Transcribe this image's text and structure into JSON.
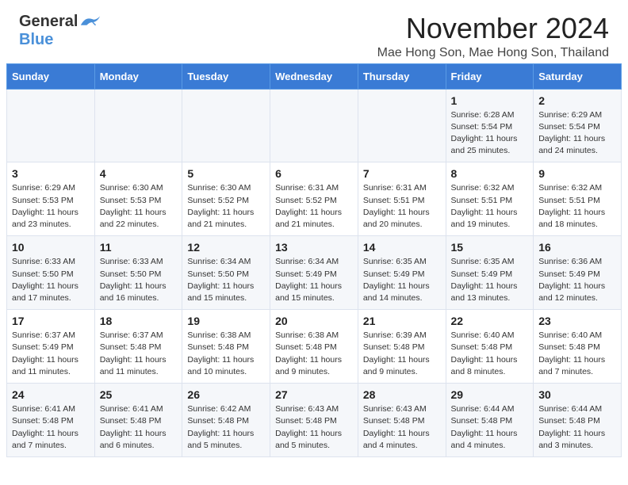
{
  "logo": {
    "general": "General",
    "blue": "Blue"
  },
  "title": "November 2024",
  "location": "Mae Hong Son, Mae Hong Son, Thailand",
  "weekdays": [
    "Sunday",
    "Monday",
    "Tuesday",
    "Wednesday",
    "Thursday",
    "Friday",
    "Saturday"
  ],
  "weeks": [
    [
      {
        "day": "",
        "info": ""
      },
      {
        "day": "",
        "info": ""
      },
      {
        "day": "",
        "info": ""
      },
      {
        "day": "",
        "info": ""
      },
      {
        "day": "",
        "info": ""
      },
      {
        "day": "1",
        "info": "Sunrise: 6:28 AM\nSunset: 5:54 PM\nDaylight: 11 hours\nand 25 minutes."
      },
      {
        "day": "2",
        "info": "Sunrise: 6:29 AM\nSunset: 5:54 PM\nDaylight: 11 hours\nand 24 minutes."
      }
    ],
    [
      {
        "day": "3",
        "info": "Sunrise: 6:29 AM\nSunset: 5:53 PM\nDaylight: 11 hours\nand 23 minutes."
      },
      {
        "day": "4",
        "info": "Sunrise: 6:30 AM\nSunset: 5:53 PM\nDaylight: 11 hours\nand 22 minutes."
      },
      {
        "day": "5",
        "info": "Sunrise: 6:30 AM\nSunset: 5:52 PM\nDaylight: 11 hours\nand 21 minutes."
      },
      {
        "day": "6",
        "info": "Sunrise: 6:31 AM\nSunset: 5:52 PM\nDaylight: 11 hours\nand 21 minutes."
      },
      {
        "day": "7",
        "info": "Sunrise: 6:31 AM\nSunset: 5:51 PM\nDaylight: 11 hours\nand 20 minutes."
      },
      {
        "day": "8",
        "info": "Sunrise: 6:32 AM\nSunset: 5:51 PM\nDaylight: 11 hours\nand 19 minutes."
      },
      {
        "day": "9",
        "info": "Sunrise: 6:32 AM\nSunset: 5:51 PM\nDaylight: 11 hours\nand 18 minutes."
      }
    ],
    [
      {
        "day": "10",
        "info": "Sunrise: 6:33 AM\nSunset: 5:50 PM\nDaylight: 11 hours\nand 17 minutes."
      },
      {
        "day": "11",
        "info": "Sunrise: 6:33 AM\nSunset: 5:50 PM\nDaylight: 11 hours\nand 16 minutes."
      },
      {
        "day": "12",
        "info": "Sunrise: 6:34 AM\nSunset: 5:50 PM\nDaylight: 11 hours\nand 15 minutes."
      },
      {
        "day": "13",
        "info": "Sunrise: 6:34 AM\nSunset: 5:49 PM\nDaylight: 11 hours\nand 15 minutes."
      },
      {
        "day": "14",
        "info": "Sunrise: 6:35 AM\nSunset: 5:49 PM\nDaylight: 11 hours\nand 14 minutes."
      },
      {
        "day": "15",
        "info": "Sunrise: 6:35 AM\nSunset: 5:49 PM\nDaylight: 11 hours\nand 13 minutes."
      },
      {
        "day": "16",
        "info": "Sunrise: 6:36 AM\nSunset: 5:49 PM\nDaylight: 11 hours\nand 12 minutes."
      }
    ],
    [
      {
        "day": "17",
        "info": "Sunrise: 6:37 AM\nSunset: 5:49 PM\nDaylight: 11 hours\nand 11 minutes."
      },
      {
        "day": "18",
        "info": "Sunrise: 6:37 AM\nSunset: 5:48 PM\nDaylight: 11 hours\nand 11 minutes."
      },
      {
        "day": "19",
        "info": "Sunrise: 6:38 AM\nSunset: 5:48 PM\nDaylight: 11 hours\nand 10 minutes."
      },
      {
        "day": "20",
        "info": "Sunrise: 6:38 AM\nSunset: 5:48 PM\nDaylight: 11 hours\nand 9 minutes."
      },
      {
        "day": "21",
        "info": "Sunrise: 6:39 AM\nSunset: 5:48 PM\nDaylight: 11 hours\nand 9 minutes."
      },
      {
        "day": "22",
        "info": "Sunrise: 6:40 AM\nSunset: 5:48 PM\nDaylight: 11 hours\nand 8 minutes."
      },
      {
        "day": "23",
        "info": "Sunrise: 6:40 AM\nSunset: 5:48 PM\nDaylight: 11 hours\nand 7 minutes."
      }
    ],
    [
      {
        "day": "24",
        "info": "Sunrise: 6:41 AM\nSunset: 5:48 PM\nDaylight: 11 hours\nand 7 minutes."
      },
      {
        "day": "25",
        "info": "Sunrise: 6:41 AM\nSunset: 5:48 PM\nDaylight: 11 hours\nand 6 minutes."
      },
      {
        "day": "26",
        "info": "Sunrise: 6:42 AM\nSunset: 5:48 PM\nDaylight: 11 hours\nand 5 minutes."
      },
      {
        "day": "27",
        "info": "Sunrise: 6:43 AM\nSunset: 5:48 PM\nDaylight: 11 hours\nand 5 minutes."
      },
      {
        "day": "28",
        "info": "Sunrise: 6:43 AM\nSunset: 5:48 PM\nDaylight: 11 hours\nand 4 minutes."
      },
      {
        "day": "29",
        "info": "Sunrise: 6:44 AM\nSunset: 5:48 PM\nDaylight: 11 hours\nand 4 minutes."
      },
      {
        "day": "30",
        "info": "Sunrise: 6:44 AM\nSunset: 5:48 PM\nDaylight: 11 hours\nand 3 minutes."
      }
    ]
  ]
}
